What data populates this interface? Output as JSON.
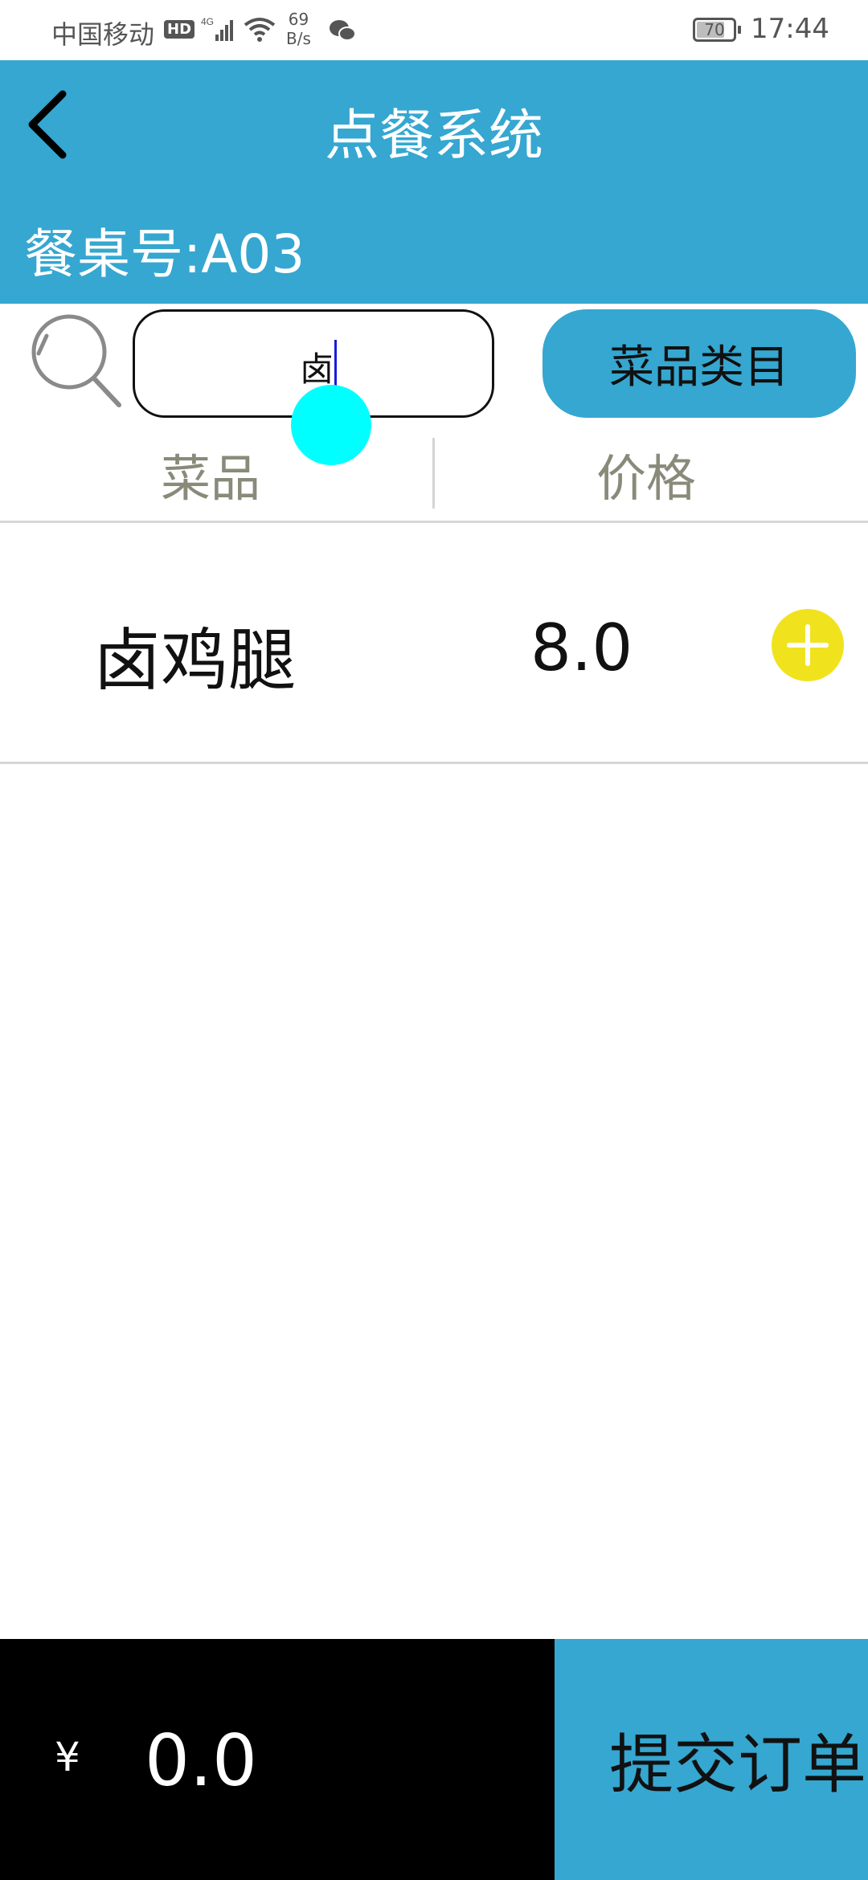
{
  "status_bar": {
    "carrier": "中国移动",
    "hd": "HD",
    "signal": "4G",
    "speed_value": "69",
    "speed_unit": "B/s",
    "battery": "70",
    "time": "17:44"
  },
  "header": {
    "title": "点餐系统",
    "table_label": "餐桌号:A03",
    "color": "#35a7d1"
  },
  "search": {
    "value": "卤"
  },
  "category_button": {
    "label": "菜品类目"
  },
  "columns": {
    "name": "菜品",
    "price": "价格"
  },
  "dishes": [
    {
      "name": "卤鸡腿",
      "price": "8.0"
    }
  ],
  "footer": {
    "currency": "¥",
    "total": "0.0",
    "submit_label": "提交订单"
  },
  "icons": {
    "back": "back-arrow-icon",
    "search": "search-icon",
    "add": "plus-icon",
    "wifi": "wifi-icon",
    "wechat": "wechat-icon"
  }
}
